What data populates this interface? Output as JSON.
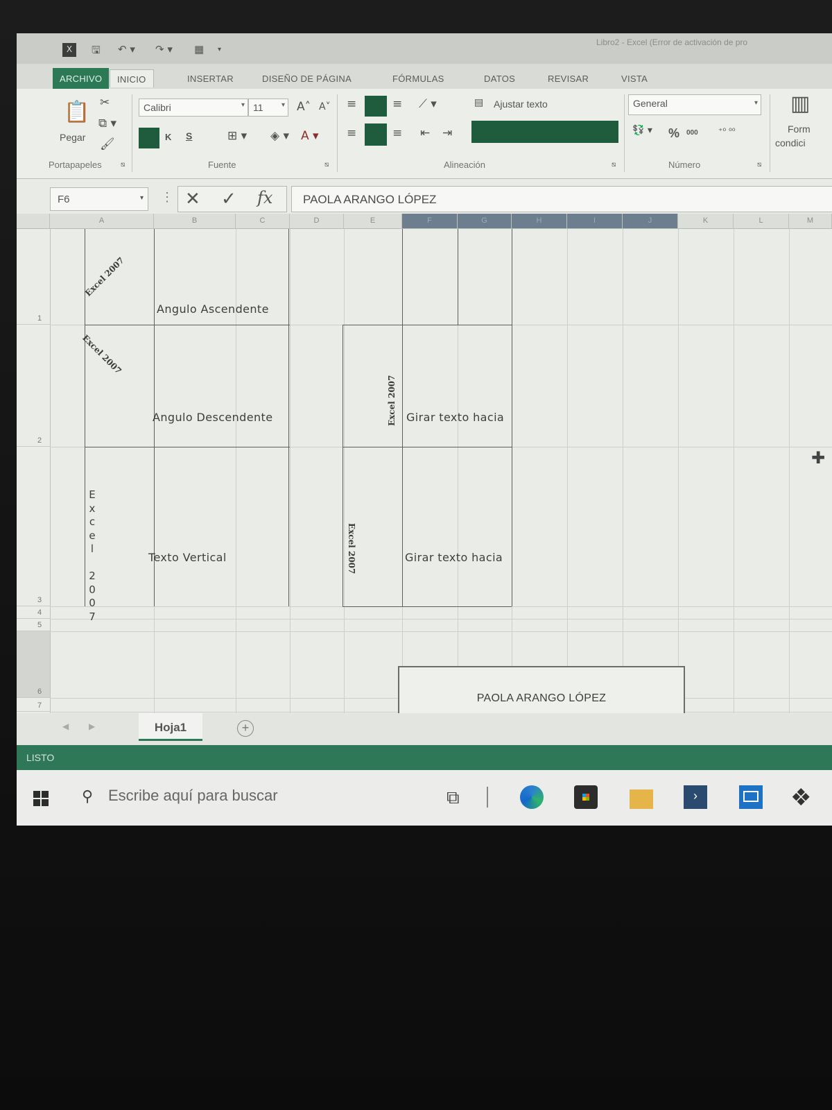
{
  "titlebar": {
    "window_title": "Libro2 - Excel (Error de activación de pro"
  },
  "ribbon_tabs": [
    {
      "label": "ARCHIVO"
    },
    {
      "label": "INICIO"
    },
    {
      "label": "INSERTAR"
    },
    {
      "label": "DISEÑO DE PÁGINA"
    },
    {
      "label": "FÓRMULAS"
    },
    {
      "label": "DATOS"
    },
    {
      "label": "REVISAR"
    },
    {
      "label": "VISTA"
    }
  ],
  "ribbon": {
    "paste_label": "Pegar",
    "clipboard_group": "Portapapeles",
    "font_name": "Calibri",
    "font_size": "11",
    "bold_label": "K",
    "underline_label": "S",
    "font_group": "Fuente",
    "wrap_text_label": "Ajustar texto",
    "alignment_group": "Alineación",
    "number_format": "General",
    "percent_label": "%",
    "thousands_label": "000",
    "number_group": "Número",
    "conditional_format_label_1": "Form",
    "conditional_format_label_2": "condici",
    "accent_color": "#2c7a55",
    "fill_swatch_color": "#1f5b3d"
  },
  "formula_bar": {
    "name_box": "F6",
    "formula_value": "PAOLA ARANGO LÓPEZ"
  },
  "grid": {
    "columns": [
      "A",
      "B",
      "C",
      "D",
      "E",
      "F",
      "G",
      "H",
      "I",
      "J",
      "K",
      "L",
      "M"
    ],
    "rows": [
      "1",
      "2",
      "3",
      "4",
      "5",
      "6",
      "7"
    ],
    "cells": {
      "A1": "Excel 2007",
      "B1": "Angulo Ascendente",
      "A2": "Excel 2007",
      "B2": "Angulo Descendente",
      "E2": "Excel 2007",
      "F2": "Girar texto hacia",
      "A3": "Excel 2007",
      "B3": "Texto Vertical",
      "E3": "Excel 2007",
      "F3": "Girar texto hacia",
      "F6": "PAOLA ARANGO LÓPEZ"
    },
    "vertical_chars": [
      "E",
      "x",
      "c",
      "e",
      "l",
      " ",
      "2",
      "0",
      "0",
      "7"
    ]
  },
  "sheets": {
    "active": "Hoja1",
    "add_symbol": "+"
  },
  "status": {
    "text": "LISTO"
  },
  "taskbar": {
    "search_placeholder": "Escribe aquí para buscar"
  }
}
